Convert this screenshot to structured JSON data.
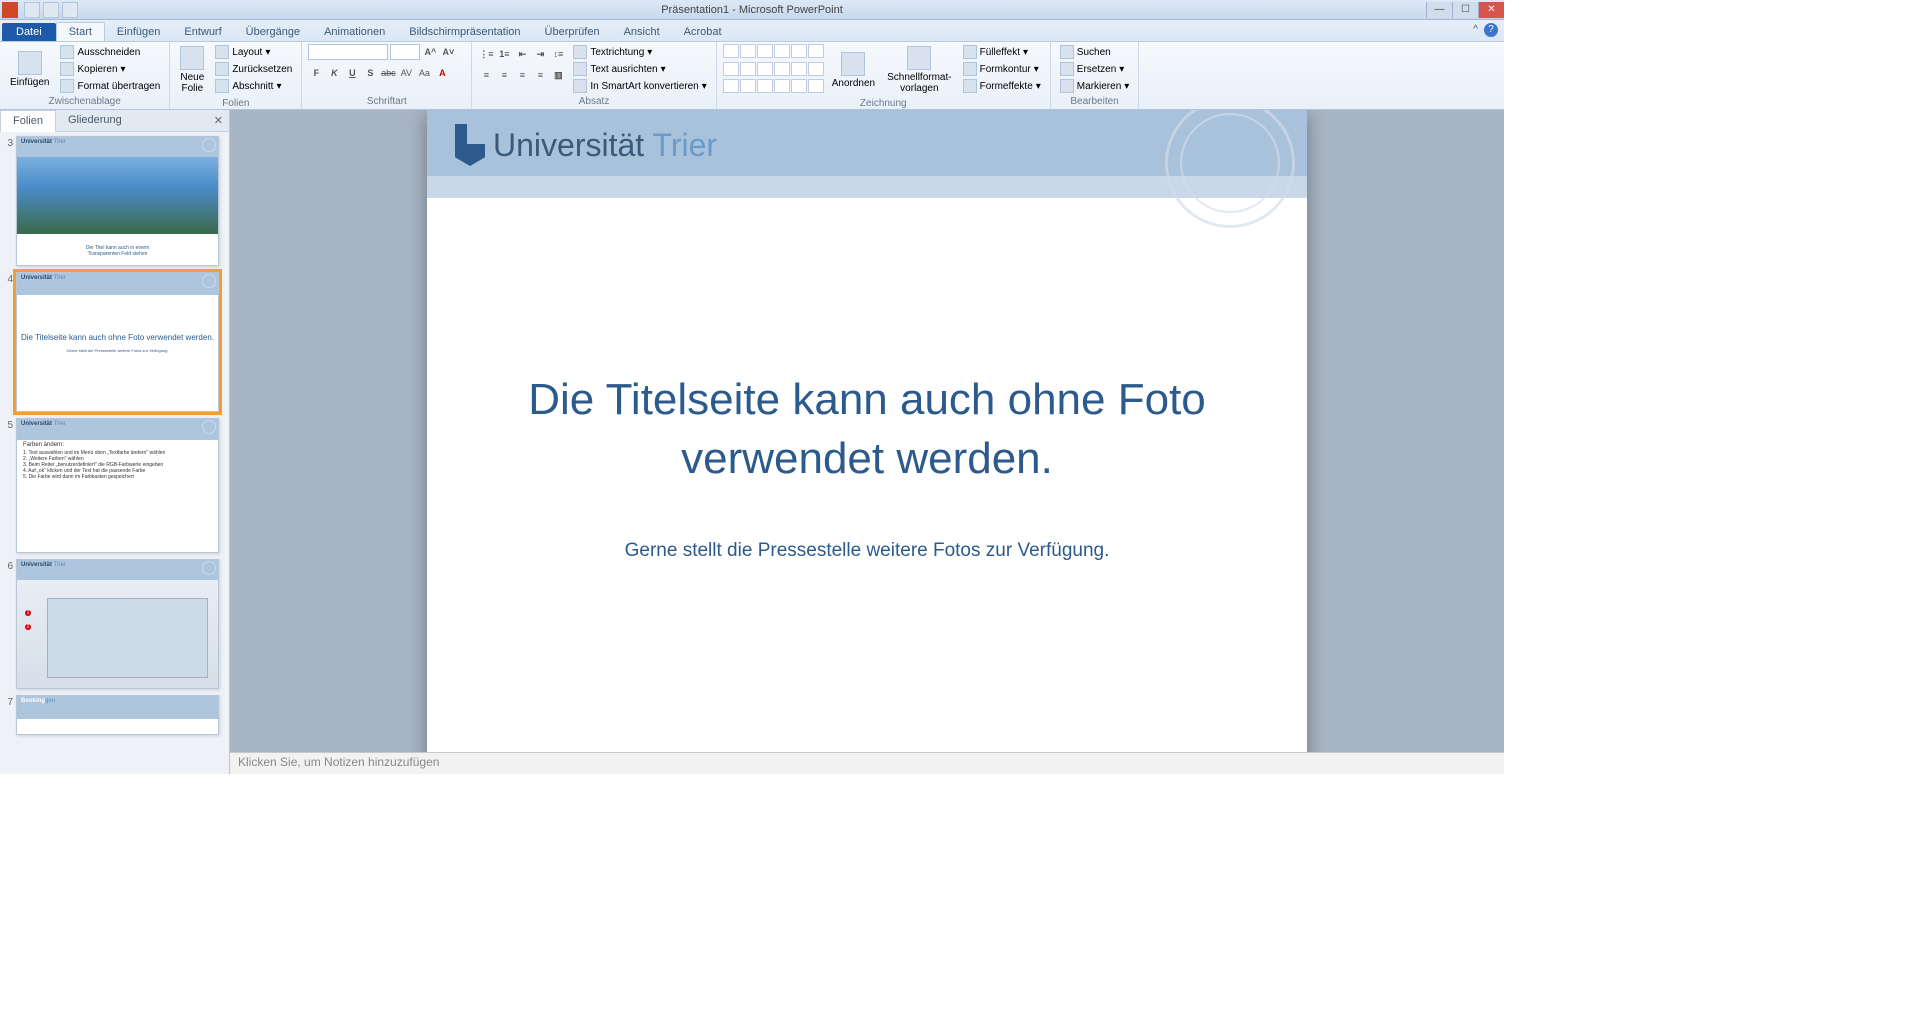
{
  "window": {
    "title": "Präsentation1 - Microsoft PowerPoint"
  },
  "tabs": {
    "file": "Datei",
    "items": [
      "Start",
      "Einfügen",
      "Entwurf",
      "Übergänge",
      "Animationen",
      "Bildschirmpräsentation",
      "Überprüfen",
      "Ansicht",
      "Acrobat"
    ],
    "active": "Start"
  },
  "ribbon": {
    "clipboard": {
      "label": "Zwischenablage",
      "paste": "Einfügen",
      "cut": "Ausschneiden",
      "copy": "Kopieren",
      "format": "Format übertragen"
    },
    "slides": {
      "label": "Folien",
      "new": "Neue\nFolie",
      "layout": "Layout",
      "reset": "Zurücksetzen",
      "section": "Abschnitt"
    },
    "font": {
      "label": "Schriftart",
      "buttons": [
        "F",
        "K",
        "U",
        "S",
        "abc",
        "AV",
        "Aa",
        "A"
      ]
    },
    "paragraph": {
      "label": "Absatz",
      "textdir": "Textrichtung",
      "align": "Text ausrichten",
      "smartart": "In SmartArt konvertieren"
    },
    "drawing": {
      "label": "Zeichnung",
      "arrange": "Anordnen",
      "quickstyles": "Schnellformat-\nvorlagen",
      "fill": "Fülleffekt",
      "outline": "Formkontur",
      "effects": "Formeffekte"
    },
    "editing": {
      "label": "Bearbeiten",
      "find": "Suchen",
      "replace": "Ersetzen",
      "select": "Markieren"
    }
  },
  "panel": {
    "tab_slides": "Folien",
    "tab_outline": "Gliederung"
  },
  "thumbs": [
    {
      "num": "3",
      "type": "photo",
      "logo": "Universität",
      "logo2": "Trier",
      "caption": "Der Titel kann auch in einem\nTransparenten Feld stehen"
    },
    {
      "num": "4",
      "type": "title",
      "logo": "Universität",
      "logo2": "Trier",
      "title": "Die Titelseite kann auch ohne Foto verwendet werden.",
      "sub": "Gerne stellt die Pressestelle weitere Fotos zur Verfügung."
    },
    {
      "num": "5",
      "type": "list",
      "logo": "Universität",
      "logo2": "Trier",
      "heading": "Farben ändern:",
      "items": [
        "Text auswählen und im Menü oben „Textfarbe ändern\" wählen",
        "„Weitere Farben\" wählen",
        "Beim Reiter „benutzerdefiniert\" die RGB-Farbwerte eingeben",
        "Auf „ok\" klicken und der Text hat die passende Farbe",
        "Die Farbe wird dann im Farbkasten gespeichert"
      ]
    },
    {
      "num": "6",
      "type": "screenshot",
      "logo": "Universität",
      "logo2": "Trier"
    },
    {
      "num": "7",
      "type": "partial",
      "logo": "Booking",
      "logo2": "gen"
    }
  ],
  "slide": {
    "logo_main": "Universität",
    "logo_sub": "Trier",
    "title": "Die Titelseite kann auch ohne Foto verwendet werden.",
    "subtitle": "Gerne stellt die Pressestelle weitere Fotos zur Verfügung."
  },
  "notes": {
    "placeholder": "Klicken Sie, um Notizen hinzuzufügen"
  }
}
